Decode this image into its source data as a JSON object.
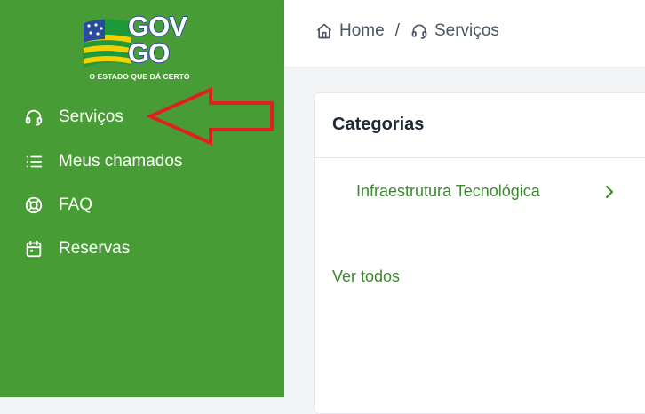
{
  "logo": {
    "text_line1": "GOV",
    "text_line2": "GO",
    "tagline": "O ESTADO QUE DÁ CERTO"
  },
  "sidebar": {
    "items": [
      {
        "label": "Serviços",
        "icon": "headset-icon"
      },
      {
        "label": "Meus chamados",
        "icon": "list-icon"
      },
      {
        "label": "FAQ",
        "icon": "lifebuoy-icon"
      },
      {
        "label": "Reservas",
        "icon": "calendar-icon"
      }
    ]
  },
  "breadcrumb": {
    "home": "Home",
    "separator": "/",
    "current": "Serviços"
  },
  "card": {
    "title": "Categorias",
    "categories": [
      "Infraestrutura Tecnológica"
    ],
    "see_all": "Ver todos"
  },
  "colors": {
    "sidebar_bg": "#479c35",
    "accent_green": "#3b8a2e",
    "arrow_red": "#e02020"
  }
}
